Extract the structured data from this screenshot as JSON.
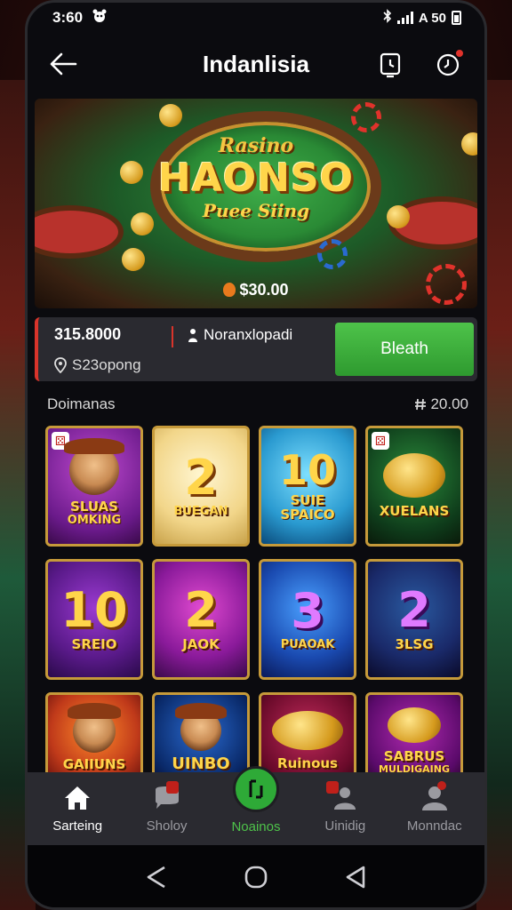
{
  "status_bar": {
    "time": "3:60",
    "right_text": "A 50"
  },
  "app_bar": {
    "title": "Indanlisia"
  },
  "hero": {
    "brand_top": "Rasino",
    "brand_main": "HAONSO",
    "brand_sub": "Puee Siing",
    "jackpot": "$30.00"
  },
  "wallet": {
    "balance": "315.8000",
    "code": "S23opong",
    "name": "Noranxlopadi",
    "cta_label": "Bleath"
  },
  "section": {
    "title": "Doimanas",
    "count": "20.00"
  },
  "games": [
    {
      "big": "",
      "label": "SLUAS",
      "label2": "OMKING",
      "kind": "figure",
      "dice": true
    },
    {
      "big": "2",
      "label": "BUEGAN",
      "label2": "",
      "kind": "number",
      "dice": false
    },
    {
      "big": "10",
      "label": "SUIE",
      "label2": "SPAICO",
      "kind": "number",
      "dice": false
    },
    {
      "big": "",
      "label": "XUELANS",
      "label2": "",
      "kind": "badge",
      "dice": true
    },
    {
      "big": "10",
      "label": "SREIO",
      "label2": "",
      "kind": "number",
      "dice": false
    },
    {
      "big": "2",
      "label": "JAOK",
      "label2": "",
      "kind": "number",
      "dice": false
    },
    {
      "big": "3",
      "label": "PUAOAK",
      "label2": "",
      "kind": "number",
      "dice": false
    },
    {
      "big": "2",
      "label": "3LSG",
      "label2": "",
      "kind": "number",
      "dice": false
    },
    {
      "big": "",
      "label": "GAIIUNS",
      "label2": "",
      "kind": "figure",
      "dice": false
    },
    {
      "big": "",
      "label": "UINBO",
      "label2": "",
      "kind": "figure",
      "dice": false
    },
    {
      "big": "",
      "label": "Ruinous",
      "label2": "",
      "kind": "badge",
      "dice": false
    },
    {
      "big": "",
      "label": "SABRUS",
      "label2": "MULDIGAING",
      "kind": "badge",
      "dice": false
    }
  ],
  "bottom_nav": [
    {
      "label": "Sarteing",
      "icon": "home-icon",
      "badge": false
    },
    {
      "label": "Sholoy",
      "icon": "chat-icon",
      "badge": true
    },
    {
      "label": "Noainos",
      "icon": "games-icon",
      "badge": false
    },
    {
      "label": "Uinidig",
      "icon": "people-icon",
      "badge": true
    },
    {
      "label": "Monndac",
      "icon": "profile-icon",
      "badge": true
    }
  ],
  "colors": {
    "accent_green": "#2eaa37",
    "accent_red": "#d9342b",
    "gold": "#ffd54a"
  }
}
